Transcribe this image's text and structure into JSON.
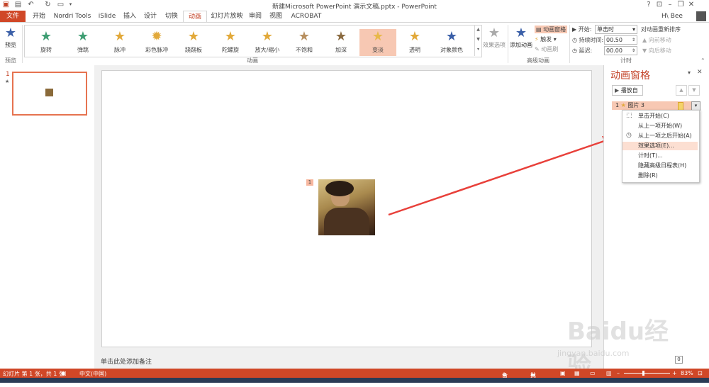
{
  "window": {
    "title": "新建Microsoft PowerPoint 演示文稿.pptx - PowerPoint",
    "user": "H\\ Bee",
    "help_label": "?"
  },
  "tabs": [
    "文件",
    "开始",
    "Nordri Tools",
    "iSlide",
    "插入",
    "设计",
    "切换",
    "动画",
    "幻灯片放映",
    "审阅",
    "视图",
    "ACROBAT"
  ],
  "active_tab": "动画",
  "ribbon": {
    "preview_label": "预览",
    "preview_group_label": "预览",
    "animation_group_label": "动画",
    "effects": [
      {
        "label": "旋转",
        "color": "#3f9e73",
        "icon": "star-icon"
      },
      {
        "label": "弹跳",
        "color": "#3f9e73",
        "icon": "star-icon"
      },
      {
        "label": "脉冲",
        "color": "#e2a93a",
        "icon": "star-icon"
      },
      {
        "label": "彩色脉冲",
        "color": "#e2a93a",
        "icon": "star-burst-icon"
      },
      {
        "label": "跷跷板",
        "color": "#e2a93a",
        "icon": "star-icon"
      },
      {
        "label": "陀螺旋",
        "color": "#e2a93a",
        "icon": "star-icon"
      },
      {
        "label": "放大/缩小",
        "color": "#e2a93a",
        "icon": "star-icon"
      },
      {
        "label": "不饱和",
        "color": "#b89060",
        "icon": "star-icon"
      },
      {
        "label": "加深",
        "color": "#8a6a40",
        "icon": "star-icon"
      },
      {
        "label": "变淡",
        "color": "#e8b84a",
        "icon": "star-icon"
      },
      {
        "label": "透明",
        "color": "#e2a93a",
        "icon": "star-icon"
      },
      {
        "label": "对象颜色",
        "color": "#3a5fa8",
        "icon": "star-icon"
      }
    ],
    "selected_effect": "变淡",
    "effect_options_label": "效果选项",
    "add_animation_label": "添加动画",
    "animation_pane_label": "动画窗格",
    "trigger_label": "触发",
    "animation_painter_label": "动画刷",
    "advanced_group_label": "高级动画",
    "start_label": "开始:",
    "start_value": "单击时",
    "duration_label": "持续时间:",
    "duration_value": "00.50",
    "delay_label": "延迟:",
    "delay_value": "00.00",
    "reorder_label": "对动画重新排序",
    "move_earlier_label": "向前移动",
    "move_later_label": "向后移动",
    "timing_group_label": "计时"
  },
  "thumbnails": [
    {
      "number": "1",
      "marker": "★"
    }
  ],
  "slide": {
    "anim_tag": "1"
  },
  "notes_placeholder": "单击此处添加备注",
  "animation_pane": {
    "title": "动画窗格",
    "play_button": "播放自",
    "item": {
      "index": "1",
      "name": "图片 3"
    },
    "menu": [
      {
        "label": "单击开始(C)",
        "icon": "mouse-icon"
      },
      {
        "label": "从上一项开始(W)",
        "icon": ""
      },
      {
        "label": "从上一项之后开始(A)",
        "icon": "clock-icon"
      },
      {
        "label": "效果选项(E)...",
        "icon": "",
        "highlighted": true
      },
      {
        "label": "计时(T)...",
        "icon": ""
      },
      {
        "label": "隐藏高级日程表(H)",
        "icon": ""
      },
      {
        "label": "删除(R)",
        "icon": ""
      }
    ]
  },
  "statusbar": {
    "slide_info": "幻灯片 第 1 张，共 1 张",
    "language": "中文(中国)",
    "notes_label": "备注",
    "comments_label": "批注",
    "zoom": "83%"
  },
  "page_indicator": "0",
  "watermark": {
    "brand": "Baidu经验",
    "url": "jingyan.baidu.com"
  },
  "colors": {
    "accent": "#d04727",
    "highlight": "#f7c8b3",
    "arrow": "#e8403a"
  }
}
